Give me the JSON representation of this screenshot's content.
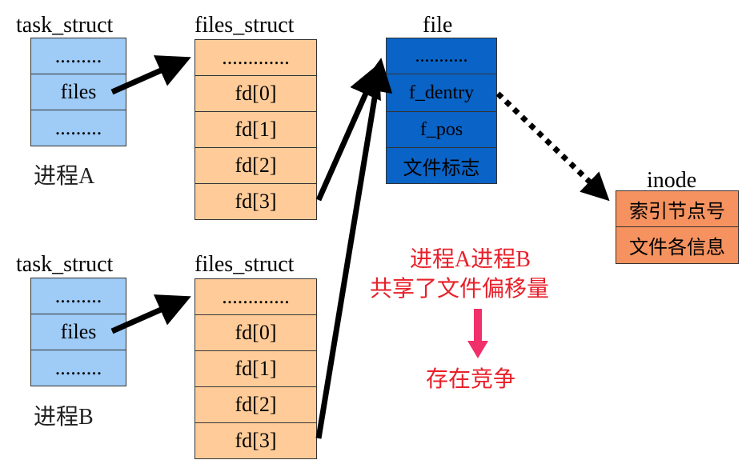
{
  "process_a": {
    "title": "task_struct",
    "rows": [
      ".........",
      "files",
      "........."
    ],
    "label": "进程A"
  },
  "process_b": {
    "title": "task_struct",
    "rows": [
      ".........",
      "files",
      "........."
    ],
    "label": "进程B"
  },
  "files_a": {
    "title": "files_struct",
    "rows": [
      ".............",
      "fd[0]",
      "fd[1]",
      "fd[2]",
      "fd[3]"
    ]
  },
  "files_b": {
    "title": "files_struct",
    "rows": [
      ".............",
      "fd[0]",
      "fd[1]",
      "fd[2]",
      "fd[3]"
    ]
  },
  "file": {
    "title": "file",
    "rows": [
      "...........",
      "f_dentry",
      "f_pos",
      "文件标志"
    ]
  },
  "inode": {
    "title": "inode",
    "rows": [
      "索引节点号",
      "文件各信息"
    ]
  },
  "note": {
    "line1": "进程A进程B",
    "line2": "共享了文件偏移量",
    "line3": "存在竞争"
  },
  "colors": {
    "task_struct": "#9fcbf7",
    "files_struct": "#ffcc99",
    "file": "#0a63c6",
    "inode": "#f6925f",
    "note": "#e8202a",
    "down_arrow": "#f0306a"
  }
}
